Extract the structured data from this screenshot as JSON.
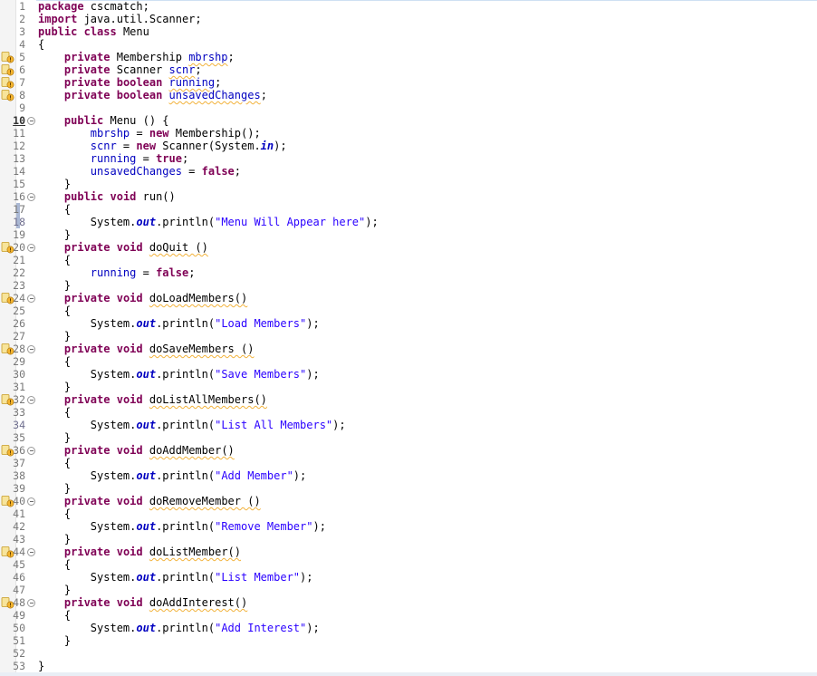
{
  "editor": {
    "language": "java",
    "colors": {
      "keyword": "#7f0055",
      "field": "#0000c0",
      "string": "#2a00ff",
      "warning": "#f2b23b"
    },
    "lines": [
      {
        "n": "1",
        "tokens": [
          {
            "t": "package",
            "c": "kw"
          },
          {
            "t": " cscmatch;"
          }
        ]
      },
      {
        "n": "2",
        "tokens": [
          {
            "t": "import",
            "c": "kw"
          },
          {
            "t": " java.util.Scanner;"
          }
        ]
      },
      {
        "n": "3",
        "tokens": [
          {
            "t": "public",
            "c": "kw"
          },
          {
            "t": " "
          },
          {
            "t": "class",
            "c": "kw"
          },
          {
            "t": " Menu"
          }
        ]
      },
      {
        "n": "4",
        "tokens": [
          {
            "t": "{"
          }
        ]
      },
      {
        "n": "5",
        "warn": true,
        "tokens": [
          {
            "t": "    "
          },
          {
            "t": "private",
            "c": "kw"
          },
          {
            "t": " Membership "
          },
          {
            "t": "mbrshp",
            "c": "fld squig"
          },
          {
            "t": ";"
          }
        ]
      },
      {
        "n": "6",
        "warn": true,
        "tokens": [
          {
            "t": "    "
          },
          {
            "t": "private",
            "c": "kw"
          },
          {
            "t": " Scanner "
          },
          {
            "t": "scnr",
            "c": "fld squig"
          },
          {
            "t": ";"
          }
        ]
      },
      {
        "n": "7",
        "warn": true,
        "tokens": [
          {
            "t": "    "
          },
          {
            "t": "private",
            "c": "kw"
          },
          {
            "t": " "
          },
          {
            "t": "boolean",
            "c": "kw"
          },
          {
            "t": " "
          },
          {
            "t": "running",
            "c": "fld squig"
          },
          {
            "t": ";"
          }
        ]
      },
      {
        "n": "8",
        "warn": true,
        "tokens": [
          {
            "t": "    "
          },
          {
            "t": "private",
            "c": "kw"
          },
          {
            "t": " "
          },
          {
            "t": "boolean",
            "c": "kw"
          },
          {
            "t": " "
          },
          {
            "t": "unsavedChanges",
            "c": "fld squig"
          },
          {
            "t": ";"
          }
        ]
      },
      {
        "n": "9",
        "tokens": [
          {
            "t": ""
          }
        ]
      },
      {
        "n": "10",
        "fold": true,
        "bold": true,
        "tokens": [
          {
            "t": "    "
          },
          {
            "t": "public",
            "c": "kw"
          },
          {
            "t": " Menu () {"
          }
        ]
      },
      {
        "n": "11",
        "tokens": [
          {
            "t": "        "
          },
          {
            "t": "mbrshp",
            "c": "fld"
          },
          {
            "t": " = "
          },
          {
            "t": "new",
            "c": "kw"
          },
          {
            "t": " Membership();"
          }
        ]
      },
      {
        "n": "12",
        "tokens": [
          {
            "t": "        "
          },
          {
            "t": "scnr",
            "c": "fld"
          },
          {
            "t": " = "
          },
          {
            "t": "new",
            "c": "kw"
          },
          {
            "t": " Scanner(System."
          },
          {
            "t": "in",
            "c": "st"
          },
          {
            "t": ");"
          }
        ]
      },
      {
        "n": "13",
        "tokens": [
          {
            "t": "        "
          },
          {
            "t": "running",
            "c": "fld"
          },
          {
            "t": " = "
          },
          {
            "t": "true",
            "c": "kw"
          },
          {
            "t": ";"
          }
        ]
      },
      {
        "n": "14",
        "tokens": [
          {
            "t": "        "
          },
          {
            "t": "unsavedChanges",
            "c": "fld"
          },
          {
            "t": " = "
          },
          {
            "t": "false",
            "c": "kw"
          },
          {
            "t": ";"
          }
        ]
      },
      {
        "n": "15",
        "tokens": [
          {
            "t": "    }"
          }
        ]
      },
      {
        "n": "16",
        "fold": true,
        "tokens": [
          {
            "t": "    "
          },
          {
            "t": "public",
            "c": "kw"
          },
          {
            "t": " "
          },
          {
            "t": "void",
            "c": "kw"
          },
          {
            "t": " run()"
          }
        ]
      },
      {
        "n": "17",
        "hl": true,
        "tokens": [
          {
            "t": "    {"
          }
        ]
      },
      {
        "n": "18",
        "hl": true,
        "mark": true,
        "tokens": [
          {
            "t": "        System."
          },
          {
            "t": "out",
            "c": "st"
          },
          {
            "t": ".println("
          },
          {
            "t": "\"Menu Will Appear here\"",
            "c": "str"
          },
          {
            "t": ");"
          }
        ]
      },
      {
        "n": "19",
        "tokens": [
          {
            "t": "    }"
          }
        ]
      },
      {
        "n": "20",
        "warn": true,
        "fold": true,
        "tokens": [
          {
            "t": "    "
          },
          {
            "t": "private",
            "c": "kw"
          },
          {
            "t": " "
          },
          {
            "t": "void",
            "c": "kw"
          },
          {
            "t": " "
          },
          {
            "t": "doQuit ()",
            "c": "squig"
          }
        ]
      },
      {
        "n": "21",
        "tokens": [
          {
            "t": "    {"
          }
        ]
      },
      {
        "n": "22",
        "tokens": [
          {
            "t": "        "
          },
          {
            "t": "running",
            "c": "fld"
          },
          {
            "t": " = "
          },
          {
            "t": "false",
            "c": "kw"
          },
          {
            "t": ";"
          }
        ]
      },
      {
        "n": "23",
        "tokens": [
          {
            "t": "    }"
          }
        ]
      },
      {
        "n": "24",
        "warn": true,
        "fold": true,
        "tokens": [
          {
            "t": "    "
          },
          {
            "t": "private",
            "c": "kw"
          },
          {
            "t": " "
          },
          {
            "t": "void",
            "c": "kw"
          },
          {
            "t": " "
          },
          {
            "t": "doLoadMembers()",
            "c": "squig"
          }
        ]
      },
      {
        "n": "25",
        "tokens": [
          {
            "t": "    {"
          }
        ]
      },
      {
        "n": "26",
        "tokens": [
          {
            "t": "        System."
          },
          {
            "t": "out",
            "c": "st"
          },
          {
            "t": ".println("
          },
          {
            "t": "\"Load Members\"",
            "c": "str"
          },
          {
            "t": ");"
          }
        ]
      },
      {
        "n": "27",
        "tokens": [
          {
            "t": "    }"
          }
        ]
      },
      {
        "n": "28",
        "warn": true,
        "fold": true,
        "tokens": [
          {
            "t": "    "
          },
          {
            "t": "private",
            "c": "kw"
          },
          {
            "t": " "
          },
          {
            "t": "void",
            "c": "kw"
          },
          {
            "t": " "
          },
          {
            "t": "doSaveMembers ()",
            "c": "squig"
          }
        ]
      },
      {
        "n": "29",
        "tokens": [
          {
            "t": "    {"
          }
        ]
      },
      {
        "n": "30",
        "tokens": [
          {
            "t": "        System."
          },
          {
            "t": "out",
            "c": "st"
          },
          {
            "t": ".println("
          },
          {
            "t": "\"Save Members\"",
            "c": "str"
          },
          {
            "t": ");"
          }
        ]
      },
      {
        "n": "31",
        "tokens": [
          {
            "t": "    }"
          }
        ]
      },
      {
        "n": "32",
        "warn": true,
        "fold": true,
        "tokens": [
          {
            "t": "    "
          },
          {
            "t": "private",
            "c": "kw"
          },
          {
            "t": " "
          },
          {
            "t": "void",
            "c": "kw"
          },
          {
            "t": " "
          },
          {
            "t": "doListAllMembers()",
            "c": "squig"
          }
        ]
      },
      {
        "n": "33",
        "tokens": [
          {
            "t": "    {"
          }
        ]
      },
      {
        "n": "34",
        "mark": true,
        "tokens": [
          {
            "t": "        System."
          },
          {
            "t": "out",
            "c": "st"
          },
          {
            "t": ".println("
          },
          {
            "t": "\"List All Members\"",
            "c": "str"
          },
          {
            "t": ");"
          }
        ]
      },
      {
        "n": "35",
        "tokens": [
          {
            "t": "    }"
          }
        ]
      },
      {
        "n": "36",
        "warn": true,
        "fold": true,
        "tokens": [
          {
            "t": "    "
          },
          {
            "t": "private",
            "c": "kw"
          },
          {
            "t": " "
          },
          {
            "t": "void",
            "c": "kw"
          },
          {
            "t": " "
          },
          {
            "t": "doAddMember()",
            "c": "squig"
          }
        ]
      },
      {
        "n": "37",
        "tokens": [
          {
            "t": "    {"
          }
        ]
      },
      {
        "n": "38",
        "tokens": [
          {
            "t": "        System."
          },
          {
            "t": "out",
            "c": "st"
          },
          {
            "t": ".println("
          },
          {
            "t": "\"Add Member\"",
            "c": "str"
          },
          {
            "t": ");"
          }
        ]
      },
      {
        "n": "39",
        "tokens": [
          {
            "t": "    }"
          }
        ]
      },
      {
        "n": "40",
        "warn": true,
        "fold": true,
        "tokens": [
          {
            "t": "    "
          },
          {
            "t": "private",
            "c": "kw"
          },
          {
            "t": " "
          },
          {
            "t": "void",
            "c": "kw"
          },
          {
            "t": " "
          },
          {
            "t": "doRemoveMember ()",
            "c": "squig"
          }
        ]
      },
      {
        "n": "41",
        "tokens": [
          {
            "t": "    {"
          }
        ]
      },
      {
        "n": "42",
        "tokens": [
          {
            "t": "        System."
          },
          {
            "t": "out",
            "c": "st"
          },
          {
            "t": ".println("
          },
          {
            "t": "\"Remove Member\"",
            "c": "str"
          },
          {
            "t": ");"
          }
        ]
      },
      {
        "n": "43",
        "tokens": [
          {
            "t": "    }"
          }
        ]
      },
      {
        "n": "44",
        "warn": true,
        "fold": true,
        "tokens": [
          {
            "t": "    "
          },
          {
            "t": "private",
            "c": "kw"
          },
          {
            "t": " "
          },
          {
            "t": "void",
            "c": "kw"
          },
          {
            "t": " "
          },
          {
            "t": "doListMember()",
            "c": "squig"
          }
        ]
      },
      {
        "n": "45",
        "tokens": [
          {
            "t": "    {"
          }
        ]
      },
      {
        "n": "46",
        "tokens": [
          {
            "t": "        System."
          },
          {
            "t": "out",
            "c": "st"
          },
          {
            "t": ".println("
          },
          {
            "t": "\"List Member\"",
            "c": "str"
          },
          {
            "t": ");"
          }
        ]
      },
      {
        "n": "47",
        "tokens": [
          {
            "t": "    }"
          }
        ]
      },
      {
        "n": "48",
        "warn": true,
        "fold": true,
        "tokens": [
          {
            "t": "    "
          },
          {
            "t": "private",
            "c": "kw"
          },
          {
            "t": " "
          },
          {
            "t": "void",
            "c": "kw"
          },
          {
            "t": " "
          },
          {
            "t": "doAddInterest()",
            "c": "squig"
          }
        ]
      },
      {
        "n": "49",
        "tokens": [
          {
            "t": "    {"
          }
        ]
      },
      {
        "n": "50",
        "tokens": [
          {
            "t": "        System."
          },
          {
            "t": "out",
            "c": "st"
          },
          {
            "t": ".println("
          },
          {
            "t": "\"Add Interest\"",
            "c": "str"
          },
          {
            "t": ");"
          }
        ]
      },
      {
        "n": "51",
        "tokens": [
          {
            "t": "    }"
          }
        ]
      },
      {
        "n": "52",
        "tokens": [
          {
            "t": ""
          }
        ]
      },
      {
        "n": "53",
        "tokens": [
          {
            "t": "}"
          }
        ]
      }
    ]
  }
}
